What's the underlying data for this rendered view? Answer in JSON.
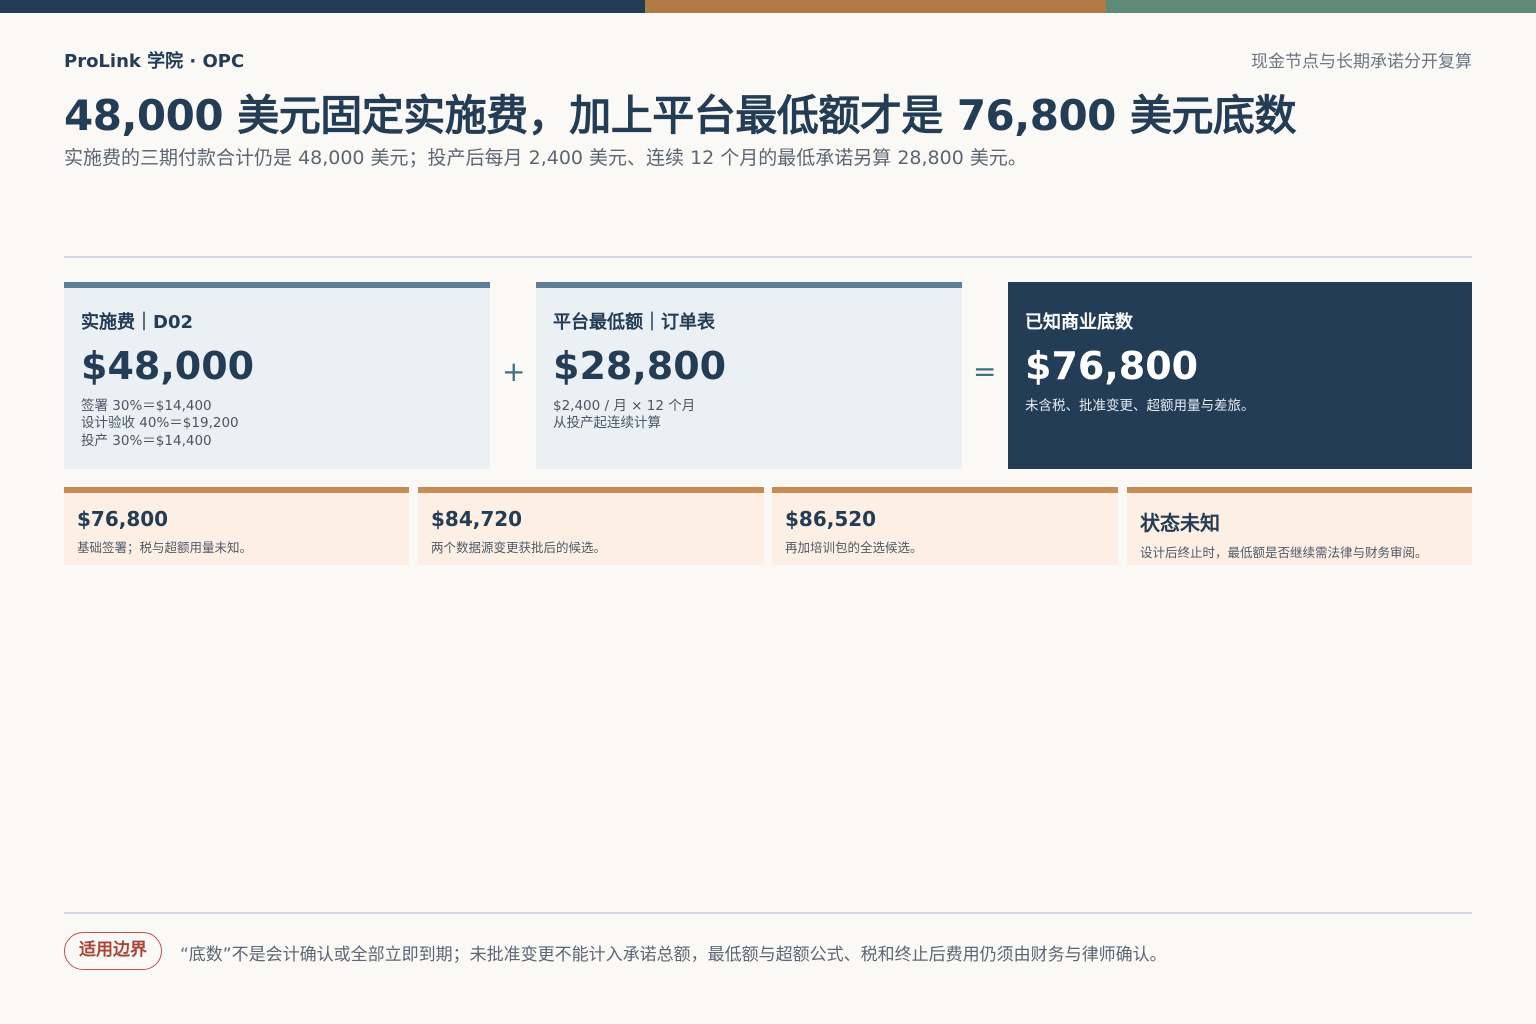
{
  "header": {
    "brand": "ProLink 学院 · OPC",
    "tagline": "现金节点与长期承诺分开复算",
    "title": "48,000 美元固定实施费，加上平台最低额才是 76,800 美元底数",
    "subtitle": "实施费的三期付款合计仍是 48,000 美元；投产后每月 2,400 美元、连续 12 个月的最低承诺另算 28,800 美元。"
  },
  "formula": {
    "implementation": {
      "label": "实施费｜D02",
      "amount": "$48,000",
      "notes": [
        "签署 30%＝$14,400",
        "设计验收 40%＝$19,200",
        "投产 30%＝$14,400"
      ]
    },
    "plus_symbol": "+",
    "platform": {
      "label": "平台最低额｜订单表",
      "amount": "$28,800",
      "notes": [
        "$2,400 / 月 × 12 个月",
        "从投产起连续计算"
      ]
    },
    "equals_symbol": "=",
    "total": {
      "label": "已知商业底数",
      "amount": "$76,800",
      "note": "未含税、批准变更、超额用量与差旅。"
    }
  },
  "scenarios": [
    {
      "value": "$76,800",
      "desc": "基础签署；税与超额用量未知。"
    },
    {
      "value": "$84,720",
      "desc": "两个数据源变更获批后的候选。"
    },
    {
      "value": "$86,520",
      "desc": "再加培训包的全选候选。"
    },
    {
      "value": "状态未知",
      "desc": "设计后终止时，最低额是否继续需法律与财务审阅。"
    }
  ],
  "footer": {
    "badge": "适用边界",
    "note": "“底数”不是会计确认或全部立即到期；未批准变更不能计入承诺总额，最低额与超额公式、税和终止后费用仍须由财务与律师确认。"
  },
  "colors": {
    "navy": "#243d57",
    "bronze": "#b07a44",
    "teal": "#5e8a7a",
    "card_light": "#eaf0f4",
    "scenario_bg": "#fdefe3",
    "badge_red": "#b4584a"
  }
}
